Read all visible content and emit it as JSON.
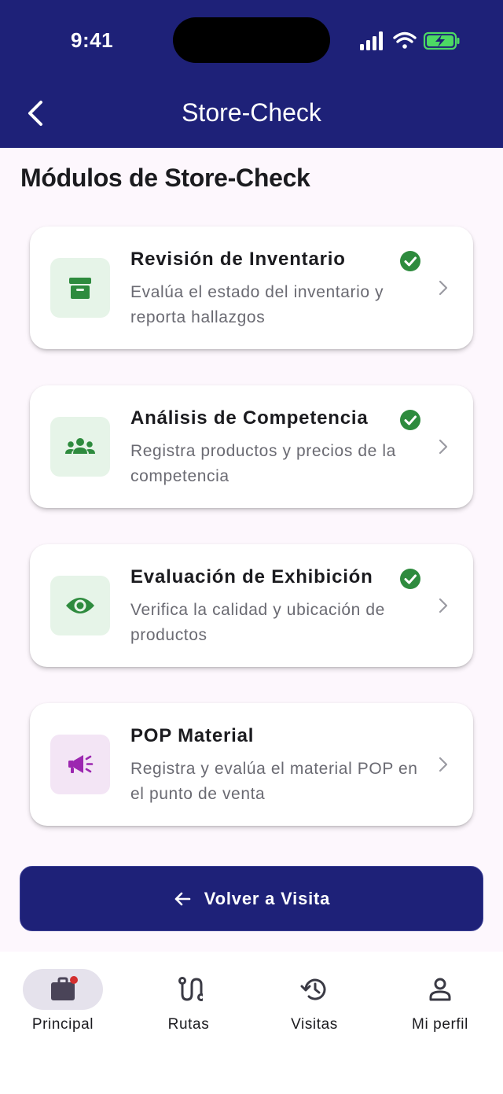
{
  "status": {
    "time": "9:41"
  },
  "header": {
    "title": "Store-Check"
  },
  "section_title": "Módulos de Store-Check",
  "modules": [
    {
      "title": "Revisión de Inventario",
      "description": "Evalúa el estado del inventario y reporta hallazgos",
      "icon": "archive-icon",
      "completed": true,
      "accent": "#2e8b3e",
      "bg": "#e6f4e8"
    },
    {
      "title": "Análisis de Competencia",
      "description": "Registra productos y precios de la competencia",
      "icon": "groups-icon",
      "completed": true,
      "accent": "#2e8b3e",
      "bg": "#e6f4e8"
    },
    {
      "title": "Evaluación de Exhibición",
      "description": "Verifica la calidad y ubicación de productos",
      "icon": "eye-icon",
      "completed": true,
      "accent": "#2e8b3e",
      "bg": "#e6f4e8"
    },
    {
      "title": "POP Material",
      "description": "Registra y evalúa el material POP en el punto de venta",
      "icon": "megaphone-icon",
      "completed": false,
      "accent": "#9c27b0",
      "bg": "#f3e5f5"
    }
  ],
  "back_button": {
    "label": "Volver a Visita"
  },
  "bottom_nav": [
    {
      "label": "Principal",
      "icon": "briefcase-icon",
      "active": true,
      "badge": true
    },
    {
      "label": "Rutas",
      "icon": "route-icon",
      "active": false
    },
    {
      "label": "Visitas",
      "icon": "history-icon",
      "active": false
    },
    {
      "label": "Mi perfil",
      "icon": "person-icon",
      "active": false
    }
  ],
  "colors": {
    "primary": "#1e2178",
    "success": "#2e8b3e",
    "pop": "#9c27b0",
    "background": "#fdf7fd"
  }
}
